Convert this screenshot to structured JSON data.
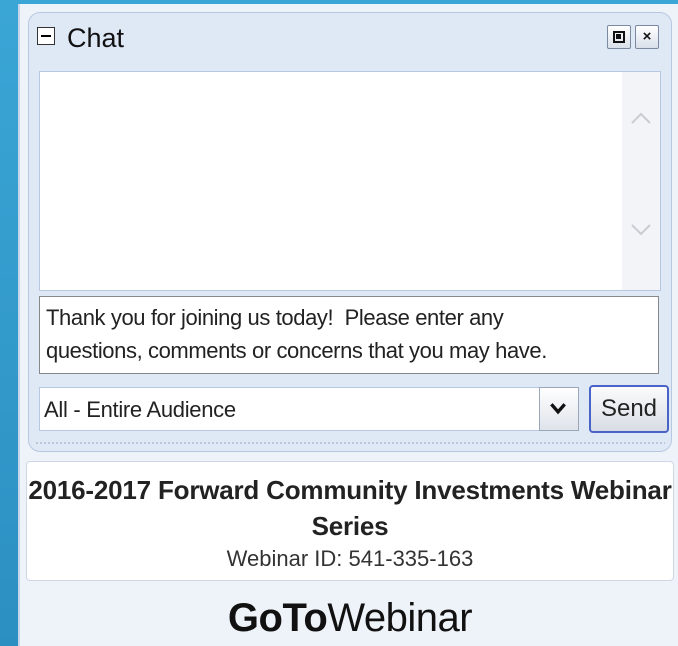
{
  "chat": {
    "title": "Chat",
    "collapse_icon": "minus-icon",
    "popout_icon": "popout-icon",
    "close_label": "×",
    "scroll_up_icon": "chevron-up-icon",
    "scroll_down_icon": "chevron-down-icon",
    "message_text": "Thank you for joining us today!  Please enter any\nquestions, comments or concerns that you may have.",
    "audience_value": "All - Entire Audience",
    "dropdown_icon": "chevron-down-icon",
    "send_label": "Send"
  },
  "info": {
    "title": "2016-2017 Forward Community Investments Webinar Series",
    "webinar_id": "Webinar ID: 541-335-163"
  },
  "footer": {
    "brand_bold": "GoTo",
    "brand_regular": "Webinar"
  },
  "colors": {
    "background": "#3aa6d6",
    "panel": "#eef3fa",
    "send_border": "#4a63c8"
  }
}
